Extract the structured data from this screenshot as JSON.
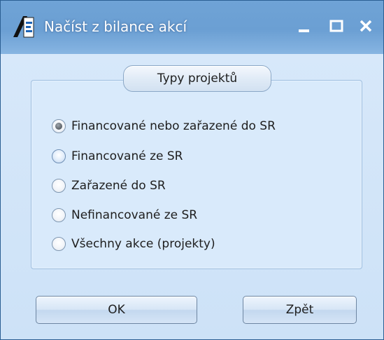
{
  "window": {
    "title": "Načíst z bilance akcí",
    "icon": "app-logo-icon",
    "controls": {
      "minimize_icon": "minimize-icon",
      "maximize_icon": "maximize-icon",
      "close_icon": "close-icon"
    }
  },
  "group": {
    "header": "Typy projektů",
    "options": [
      {
        "label": "Financované nebo zařazené do SR",
        "selected": true
      },
      {
        "label": "Financované ze SR",
        "selected": false
      },
      {
        "label": "Zařazené do SR",
        "selected": false
      },
      {
        "label": "Nefinancované ze SR",
        "selected": false
      },
      {
        "label": "Všechny akce (projekty)",
        "selected": false
      }
    ]
  },
  "buttons": {
    "ok_label": "OK",
    "back_label": "Zpět"
  },
  "colors": {
    "titlebar": "#6b9fd3",
    "body": "#d4e6f9",
    "text": "#1e1e1e"
  }
}
